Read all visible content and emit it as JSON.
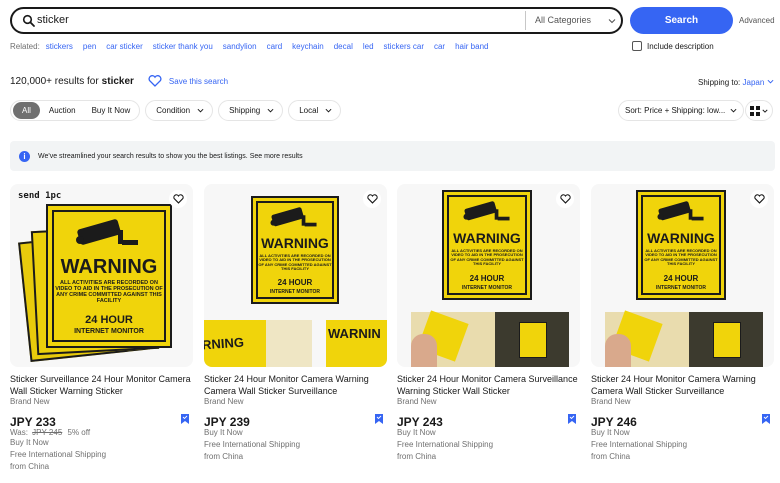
{
  "search": {
    "query": "sticker",
    "category": "All Categories",
    "button": "Search",
    "advanced": "Advanced"
  },
  "related": {
    "label": "Related:",
    "items": [
      "stickers",
      "pen",
      "car sticker",
      "sticker thank you",
      "sandylion",
      "card",
      "keychain",
      "decal",
      "led",
      "stickers car",
      "car",
      "hair band"
    ]
  },
  "include_description": "Include description",
  "results": {
    "count": "120,000+ results for",
    "keyword": "sticker",
    "save_label": "Save this search"
  },
  "shipping": {
    "label": "Shipping to:",
    "country": "Japan"
  },
  "filters": {
    "segments": [
      "All",
      "Auction",
      "Buy It Now"
    ],
    "dropdowns": [
      "Condition",
      "Shipping",
      "Local"
    ],
    "sort": "Sort: Price + Shipping: low..."
  },
  "notice": "We've streamlined your search results to show you the best listings. See more results",
  "sign_text": {
    "warning": "WARNING",
    "body": "ALL ACTIVITIES ARE RECORDED ON VIDEO TO AID IN THE PROSECUTION OF ANY CRIME COMMITTED AGAINST THIS FACILITY",
    "hour": "24 HOUR",
    "monitor": "INTERNET MONITOR",
    "peel": "RNING",
    "peel2": "WARNIN"
  },
  "listings": [
    {
      "tag": "send 1pc",
      "title": "Sticker Surveillance 24 Hour Monitor Camera Wall Sticker Warning Sticker",
      "condition": "Brand New",
      "price": "JPY 233",
      "was_label": "Was:",
      "was_price": "JPY 245",
      "discount": "5% off",
      "buy": "Buy It Now",
      "shipping": "Free International Shipping",
      "location": "from China"
    },
    {
      "title": "Sticker 24 Hour Monitor Camera Warning Camera Wall Sticker Surveillance",
      "condition": "Brand New",
      "price": "JPY 239",
      "buy": "Buy It Now",
      "shipping": "Free International Shipping",
      "location": "from China"
    },
    {
      "title": "Sticker 24 Hour Monitor Camera Surveillance Warning Sticker Wall Sticker",
      "condition": "Brand New",
      "price": "JPY 243",
      "buy": "Buy It Now",
      "shipping": "Free International Shipping",
      "location": "from China"
    },
    {
      "title": "Sticker 24 Hour Monitor Camera Warning Camera Wall Sticker Surveillance",
      "condition": "Brand New",
      "price": "JPY 246",
      "buy": "Buy It Now",
      "shipping": "Free International Shipping",
      "location": "from China"
    }
  ],
  "colors": {
    "accent": "#3665f3",
    "sign_yellow": "#f0d40b"
  }
}
